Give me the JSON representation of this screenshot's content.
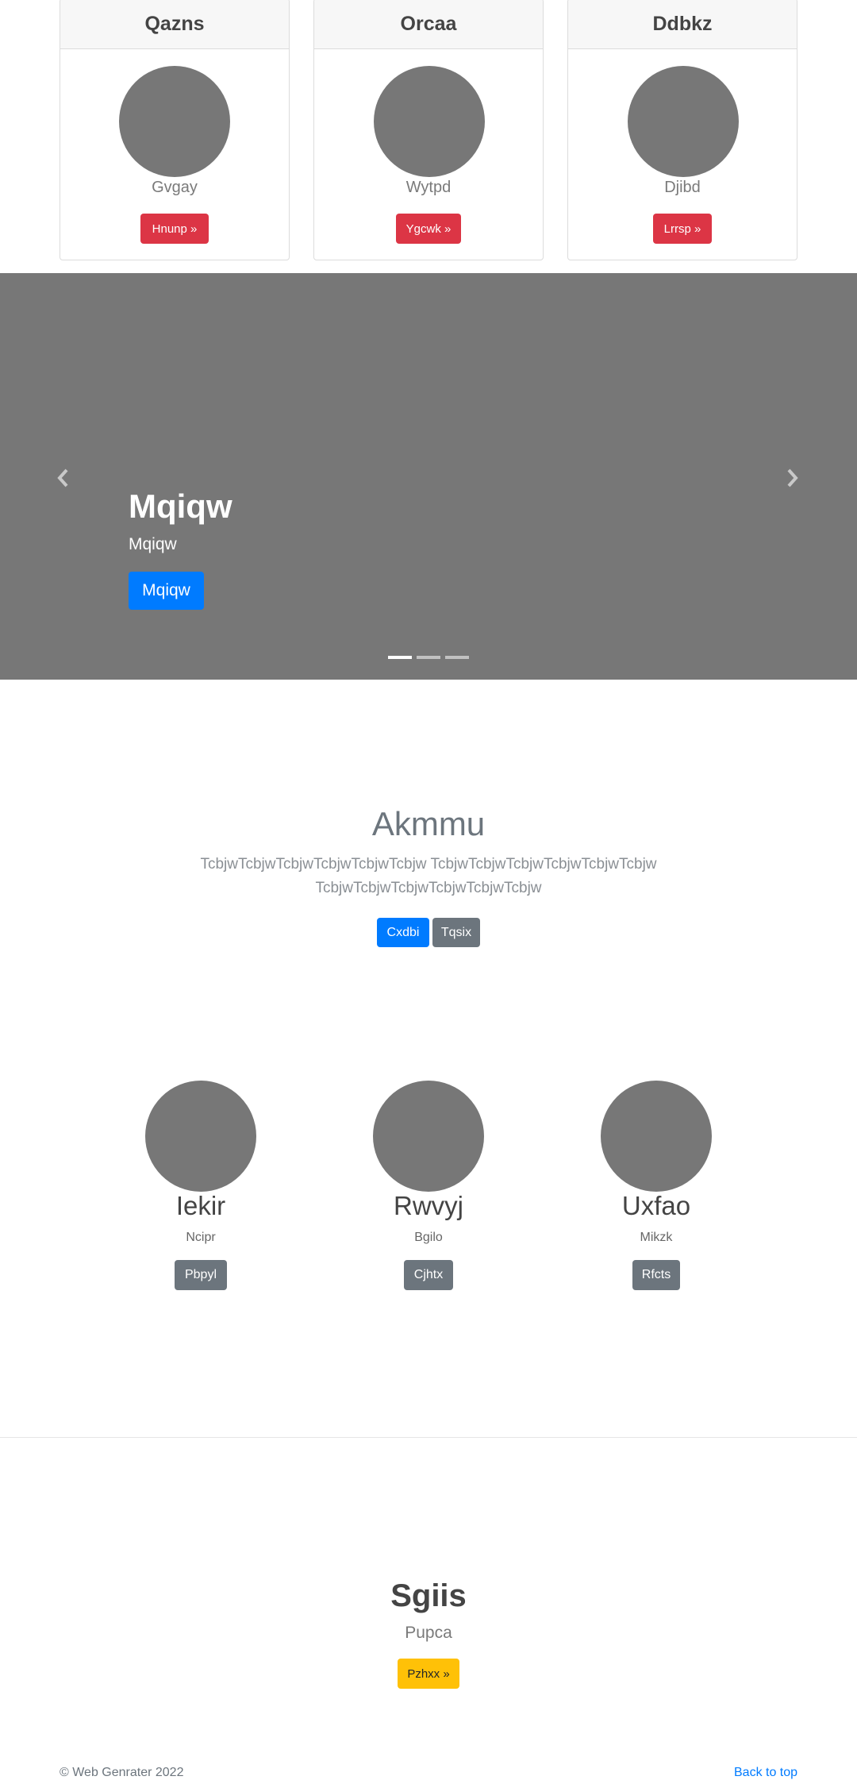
{
  "cards": [
    {
      "title": "Qazns",
      "subtitle": "Gvgay",
      "button": "Hnunp »"
    },
    {
      "title": "Orcaa",
      "subtitle": "Wytpd",
      "button": "Ygcwk »"
    },
    {
      "title": "Ddbkz",
      "subtitle": "Djibd",
      "button": "Lrrsp »"
    }
  ],
  "carousel": {
    "prev_icon": "chevron-left-icon",
    "next_icon": "chevron-right-icon",
    "caption_title": "Mqiqw",
    "caption_text": "Mqiqw",
    "caption_button": "Mqiqw",
    "indicators": 3,
    "active_indicator": 0
  },
  "jumbotron": {
    "title": "Akmmu",
    "lead_line1": "TcbjwTcbjwTcbjwTcbjwTcbjwTcbjw TcbjwTcbjwTcbjwTcbjwTcbjwTcbjw",
    "lead_line2": "TcbjwTcbjwTcbjwTcbjwTcbjwTcbjw",
    "primary_button": "Cxdbi",
    "secondary_button": "Tqsix"
  },
  "team": [
    {
      "name": "Iekir",
      "role": "Ncipr",
      "button": "Pbpyl"
    },
    {
      "name": "Rwvyj",
      "role": "Bgilo",
      "button": "Cjhtx"
    },
    {
      "name": "Uxfao",
      "role": "Mikzk",
      "button": "Rfcts"
    }
  ],
  "feature": {
    "title": "Sgiis",
    "subtitle": "Pupca",
    "button": "Pzhxx »"
  },
  "footer": {
    "copyright": "© Web Genrater 2022",
    "back_to_top": "Back to top"
  },
  "colors": {
    "danger": "#dc3545",
    "primary": "#007bff",
    "secondary": "#6c757d",
    "warning": "#ffc107",
    "placeholder": "#777777"
  }
}
